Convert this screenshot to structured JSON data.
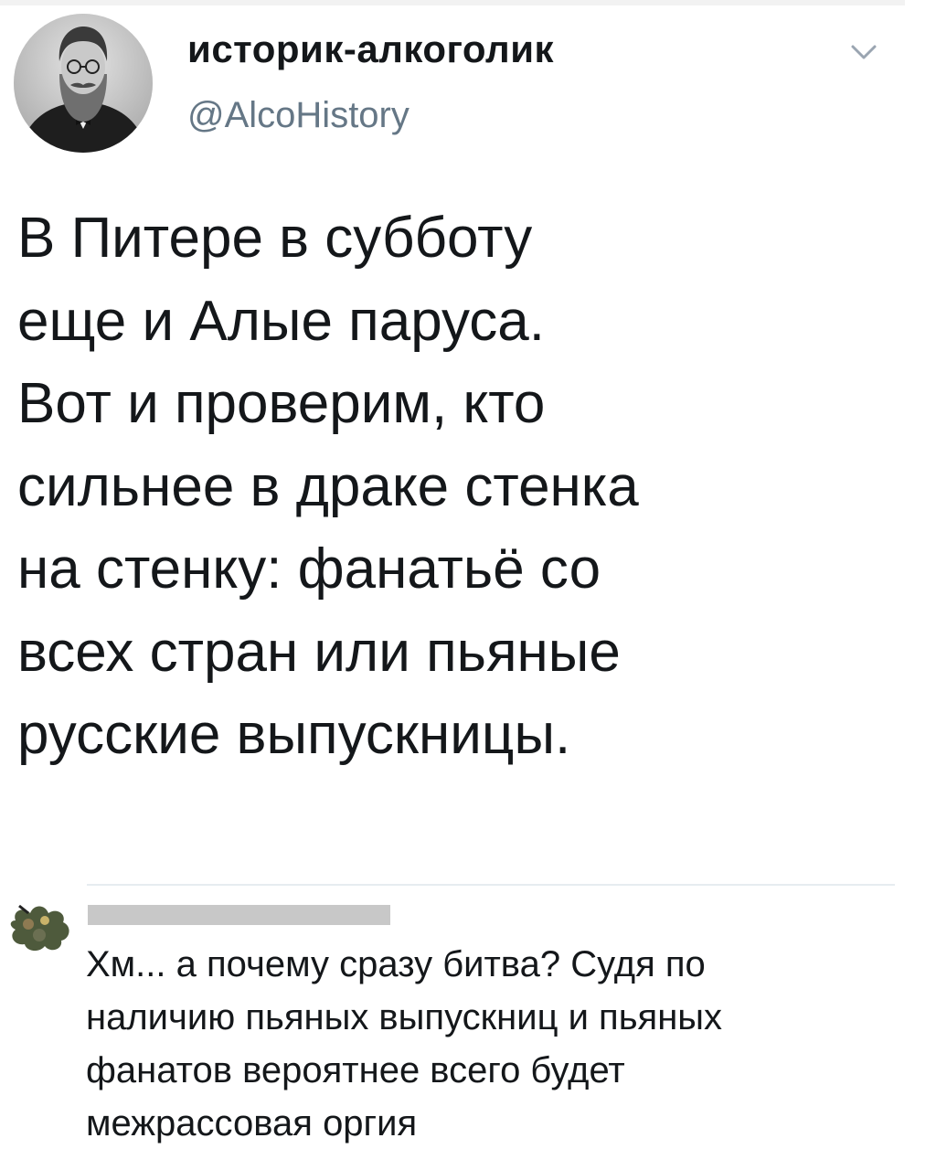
{
  "tweet": {
    "author": {
      "display_name": "историк-алкоголик",
      "handle": "@AlcoHistory",
      "avatar_icon": "profile-portrait-icon"
    },
    "menu_icon": "chevron-down-icon",
    "text_lines": [
      "В Питере в субботу",
      "еще и Алые паруса.",
      "Вот и проверим, кто",
      "сильнее в драке стенка",
      "на стенку: фанатьё со",
      "всех стран или пьяные",
      "русские выпускницы."
    ]
  },
  "reply": {
    "avatar_icon": "reply-avatar-icon",
    "text_lines": [
      "Хм... а почему сразу битва? Судя по",
      "наличию пьяных выпускниц и пьяных",
      "фанатов вероятнее всего будет",
      "межрассовая оргия"
    ]
  },
  "colors": {
    "text": "#14171a",
    "secondary_text": "#657786",
    "divider": "#e6ecf0",
    "redaction": "#c8c8c8"
  }
}
